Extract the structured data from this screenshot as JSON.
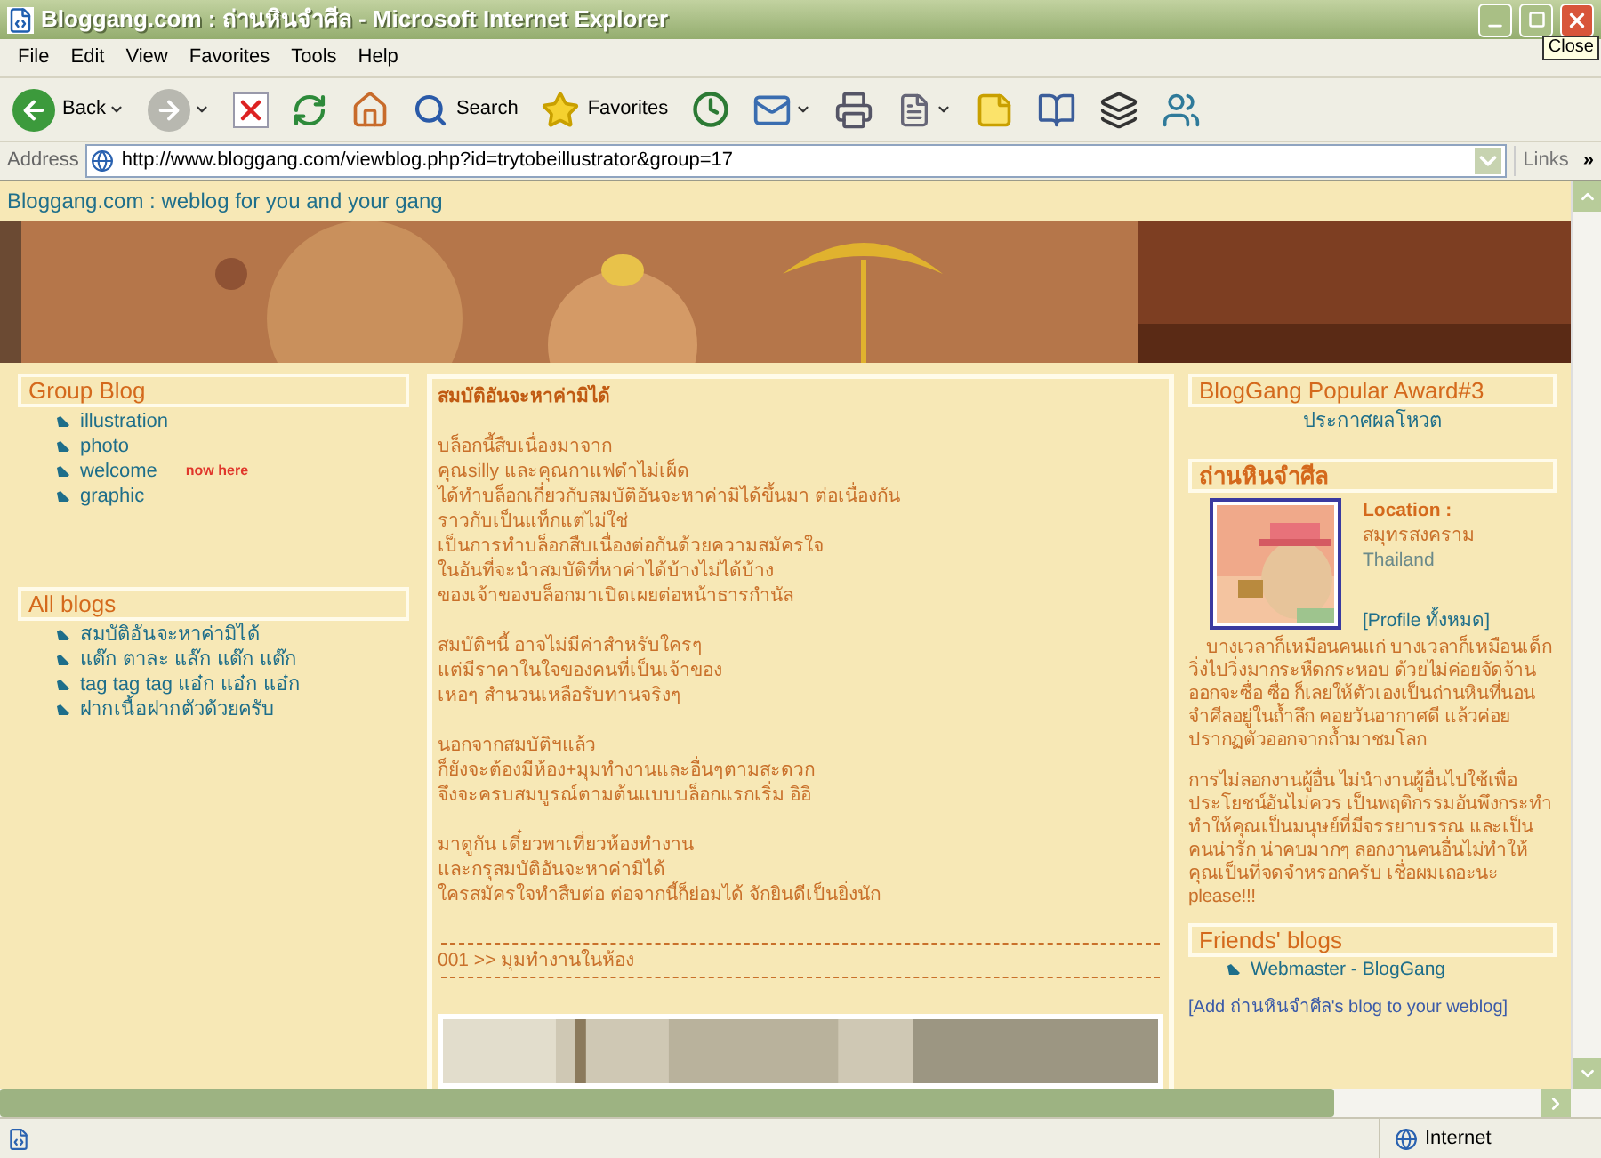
{
  "window": {
    "title": "Bloggang.com : ถ่านหินจำศีล - Microsoft Internet Explorer",
    "tooltip": "Close"
  },
  "menu": [
    "File",
    "Edit",
    "View",
    "Favorites",
    "Tools",
    "Help"
  ],
  "toolbar": [
    {
      "kind": "back",
      "label": "Back",
      "menu": true
    },
    {
      "kind": "forward",
      "menu": true
    },
    {
      "kind": "stop",
      "menu": false
    },
    {
      "kind": "refresh",
      "menu": false
    },
    {
      "kind": "home",
      "menu": false
    },
    {
      "kind": "search",
      "label": "Search",
      "menu": false
    },
    {
      "kind": "favorites",
      "label": "Favorites",
      "menu": false
    },
    {
      "kind": "history",
      "menu": false
    },
    {
      "kind": "mail",
      "menu": true
    },
    {
      "kind": "print",
      "menu": false
    },
    {
      "kind": "edit",
      "menu": true
    },
    {
      "kind": "note",
      "menu": false
    },
    {
      "kind": "research",
      "menu": false
    },
    {
      "kind": "archive",
      "menu": false
    },
    {
      "kind": "messenger",
      "menu": false
    }
  ],
  "address_bar": {
    "label": "Address",
    "url": "http://www.bloggang.com/viewblog.php?id=trytobeillustrator&group=17",
    "links": "Links",
    "more": "»"
  },
  "page": {
    "tagline": "Bloggang.com : weblog for you and your gang",
    "left": [
      {
        "title": "Group Blog",
        "items": [
          {
            "label": "illustration"
          },
          {
            "label": "photo"
          },
          {
            "label": "welcome",
            "note": "now here"
          },
          {
            "label": "graphic"
          }
        ]
      },
      {
        "title": "All blogs",
        "items": [
          {
            "label": "สมบัติอันจะหาค่ามิได้"
          },
          {
            "label": "แต๊ก ตาละ แล๊ก แต๊ก แต๊ก"
          },
          {
            "label": "tag tag tag แอ๋ก แอ๋ก แอ๋ก"
          },
          {
            "label": "ฝากเนื้อฝากตัวด้วยครับ"
          }
        ]
      }
    ],
    "post": {
      "title": "สมบัติอันจะหาค่ามิได้",
      "paragraphs": [
        [
          "บล็อกนี้สืบเนื่องมาจาก",
          "คุณsilly และคุณกาแฟดำไม่เผ็ด",
          "ได้ทำบล็อกเกี่ยวกับสมบัติอันจะหาค่ามิได้ขึ้นมา ต่อเนื่องกัน",
          "ราวกับเป็นแท็กแต่ไม่ใช่",
          "เป็นการทำบล็อกสืบเนื่องต่อกันด้วยความสมัครใจ",
          "ในอันที่จะนำสมบัติที่หาค่าได้บ้างไม่ได้บ้าง",
          "ของเจ้าของบล็อกมาเปิดเผยต่อหน้าธารกำนัล"
        ],
        [
          "สมบัติฯนี้ อาจไม่มีค่าสำหรับใครๆ",
          "แต่มีราคาในใจของคนที่เป็นเจ้าของ",
          "เหอๆ สำนวนเหลือรับทานจริงๆ"
        ],
        [
          "นอกจากสมบัติฯแล้ว",
          "ก็ยังจะต้องมีห้อง+มุมทำงานและอื่นๆตามสะดวก",
          "จึงจะครบสมบูรณ์ตามต้นแบบบล็อกแรกเริ่ม อิอิ"
        ],
        [
          "มาดูกัน เดี๋ยวพาเที่ยวห้องทำงาน",
          "และกรุสมบัติอันจะหาค่ามิได้",
          "ใครสมัครใจทำสืบต่อ ต่อจากนี้ก็ย่อมได้ จักยินดีเป็นยิ่งนัก"
        ]
      ],
      "entry": "001 >> มุมทำงานในห้อง"
    },
    "award": {
      "title": "BlogGang Popular Award#3",
      "link": "ประกาศผลโหวต"
    },
    "profile": {
      "title": "ถ่านหินจำศีล",
      "location_label": "Location :",
      "province": "สมุทรสงคราม",
      "country": "Thailand",
      "link": "[Profile ทั้งหมด]",
      "about": "บางเวลาก็เหมือนคนแก่ บางเวลาก็เหมือนเด็ก วิ่งไปวิ่งมากระหืดกระหอบ ด้วยไม่ค่อยจัดจ้าน ออกจะซื่อ ซื่อ ก็เลยให้ตัวเองเป็นถ่านหินที่นอนจำศีลอยู่ในถ้ำลึก คอยวันอากาศดี แล้วค่อยปรากฏตัวออกจากถ้ำมาชมโลก",
      "notice": "การไม่ลอกงานผู้อื่น ไม่นำงานผู้อื่นไปใช้เพื่อประโยชน์อันไม่ควร เป็นพฤติกรรมอันพึงกระทำ ทำให้คุณเป็นมนุษย์ที่มีจรรยาบรรณ และเป็นคนน่ารัก น่าคบมากๆ ลอกงานคนอื่นไม่ทำให้คุณเป็นที่จดจำหรอกครับ เชื่อผมเถอะนะ please!!!"
    },
    "friends": {
      "title": "Friends' blogs",
      "items": [
        "Webmaster - BlogGang"
      ]
    },
    "add_link": "[Add ถ่านหินจำศีล's blog to your weblog]"
  },
  "status_bar": {
    "zone": "Internet"
  }
}
